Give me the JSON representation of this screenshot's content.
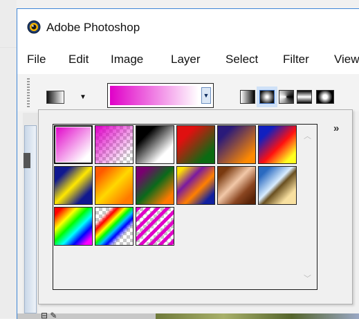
{
  "window": {
    "title": "Adobe Photoshop",
    "app_icon": "photoshop-eye-icon"
  },
  "menubar": {
    "items": [
      "File",
      "Edit",
      "Image",
      "Layer",
      "Select",
      "Filter",
      "View"
    ]
  },
  "options_bar": {
    "tool_preset_icon": "gradient-tool-preset-icon",
    "gradient_picker": {
      "current_colors": [
        "#e000c8",
        "#ffffff"
      ]
    },
    "gradient_styles": [
      "linear",
      "radial",
      "angle",
      "reflected",
      "diamond"
    ],
    "selected_style": "radial"
  },
  "gradient_popup": {
    "menu_button": "»",
    "swatches": [
      {
        "name": "Foreground to Background",
        "css": "linear-gradient(135deg,#e000c8,#ffffff 85%)",
        "selected": true
      },
      {
        "name": "Foreground to Transparent",
        "css": "linear-gradient(135deg,rgba(224,0,200,1),rgba(224,0,200,0) 85%)",
        "checker": true
      },
      {
        "name": "Black, White",
        "css": "linear-gradient(135deg,#000 25%,#fff 75%)"
      },
      {
        "name": "Red, Green",
        "css": "linear-gradient(135deg,#e01010 25%,#0b6b12 80%)"
      },
      {
        "name": "Violet, Orange",
        "css": "linear-gradient(135deg,#2a1a7a 20%,#ff8a00 85%)"
      },
      {
        "name": "Blue, Red, Yellow",
        "css": "linear-gradient(135deg,#1020c0 20%,#ff1010 55%,#ffff20 85%)"
      },
      {
        "name": "Blue, Yellow, Blue",
        "css": "linear-gradient(135deg,#101890 20%,#ffe800 50%,#101890 80%)"
      },
      {
        "name": "Orange, Yellow, Orange",
        "css": "linear-gradient(135deg,#ff5a00 15%,#ffd800 50%,#ff7a00 85%)"
      },
      {
        "name": "Violet, Green, Orange",
        "css": "linear-gradient(135deg,#7a0070 15%,#0a6a1a 50%,#ff7a00 85%)"
      },
      {
        "name": "Yellow, Violet, Orange, Blue",
        "css": "linear-gradient(135deg,#ffe000 10%,#7a1aa0 35%,#ff8000 60%,#1020a0 85%)"
      },
      {
        "name": "Copper",
        "css": "linear-gradient(135deg,#7a3a10 15%,#f2c8a8 45%,#8a4520 70%,#5a2408 90%)"
      },
      {
        "name": "Chrome",
        "css": "linear-gradient(135deg,#2a6ac0 15%,#d8ecff 45%,#6a5020 55%,#f8e0a0 80%)"
      },
      {
        "name": "Spectrum",
        "css": "linear-gradient(135deg,#ff0000 10%,#ffff00 30%,#00ff00 45%,#00ffff 60%,#0000ff 75%,#ff00ff 90%)"
      },
      {
        "name": "Transparent Rainbow",
        "css": "linear-gradient(135deg,rgba(255,0,0,0) 20%,#ff0000 30%,#ffff00 40%,#00ff00 48%,#00c0ff 56%,#0000ff 64%,rgba(255,0,255,0) 75%)",
        "checker": true
      },
      {
        "name": "Transparent Stripes",
        "css": "repeating-linear-gradient(135deg,#e000c8 0 5px,rgba(0,0,0,0) 5px 10px)",
        "checker": true
      }
    ]
  }
}
